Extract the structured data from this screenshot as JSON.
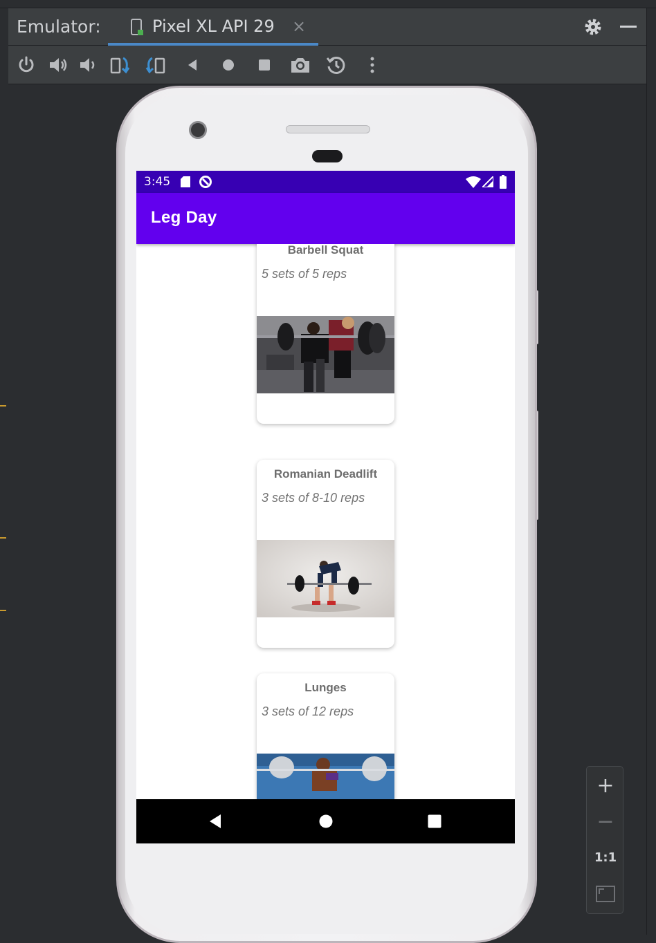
{
  "ide": {
    "panel_label": "Emulator:",
    "tab": {
      "title": "Pixel XL API 29",
      "close_glyph": "×"
    },
    "toolbar_icons": [
      "power-icon",
      "volume-up-icon",
      "volume-down-icon",
      "rotate-left-icon",
      "rotate-right-icon",
      "back-icon",
      "home-icon",
      "overview-icon",
      "camera-icon",
      "snapshot-icon",
      "more-icon"
    ],
    "zoom": {
      "plus": "+",
      "minus": "−",
      "actual": "1:1",
      "fit_icon": "fit-screen-icon"
    },
    "accent": "#4a88c7"
  },
  "device": {
    "status": {
      "time": "3:45"
    },
    "app": {
      "title": "Leg Day",
      "primary": "#6200ee",
      "primary_dark": "#3700b3"
    },
    "exercises": [
      {
        "name": "Barbell Squat",
        "sets": "5 sets of 5 reps"
      },
      {
        "name": "Romanian Deadlift",
        "sets": "3 sets of 8-10 reps"
      },
      {
        "name": "Lunges",
        "sets": "3 sets of 12 reps"
      }
    ]
  }
}
